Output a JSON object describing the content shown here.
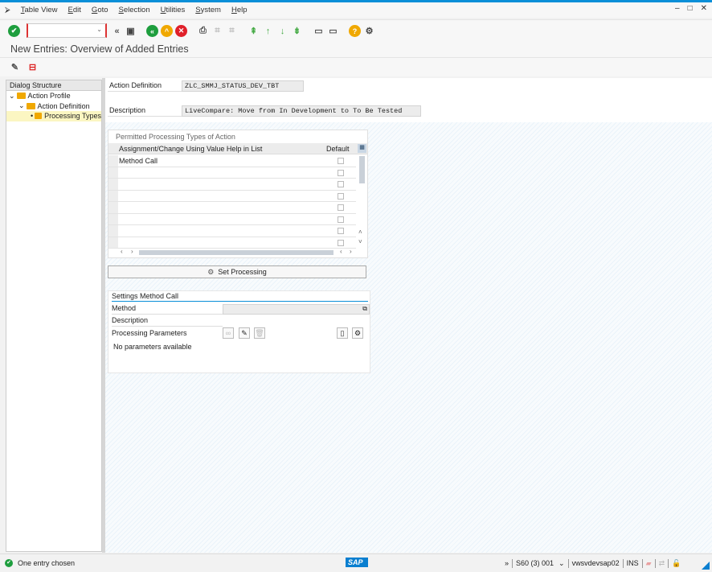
{
  "menu": [
    "Table View",
    "Edit",
    "Goto",
    "Selection",
    "Utilities",
    "System",
    "Help"
  ],
  "title": "New Entries: Overview of Added Entries",
  "dialog_structure": {
    "header": "Dialog Structure",
    "nodes": [
      {
        "label": "Action Profile"
      },
      {
        "label": "Action Definition"
      },
      {
        "label": "Processing Types",
        "selected": true
      }
    ]
  },
  "fields": {
    "action_definition_label": "Action Definition",
    "action_definition_value": "ZLC_SMMJ_STATUS_DEV_TBT",
    "description_label": "Description",
    "description_value": "LiveCompare: Move from In Development to To Be Tested"
  },
  "table": {
    "caption": "Permitted Processing Types of Action",
    "col_assignment": "Assignment/Change Using Value Help in List",
    "col_default": "Default",
    "rows": [
      {
        "value": "Method Call",
        "default": false
      },
      {
        "value": "",
        "default": false
      },
      {
        "value": "",
        "default": false
      },
      {
        "value": "",
        "default": false
      },
      {
        "value": "",
        "default": false
      },
      {
        "value": "",
        "default": false
      },
      {
        "value": "",
        "default": false
      },
      {
        "value": "",
        "default": false
      }
    ]
  },
  "set_processing_label": "Set Processing",
  "settings": {
    "title": "Settings Method Call",
    "method_label": "Method",
    "method_value": "",
    "description_label": "Description",
    "params_label": "Processing Parameters",
    "no_params": "No parameters available"
  },
  "status": {
    "message": "One entry chosen",
    "system": "S60 (3) 001",
    "server": "vwsvdevsap02",
    "mode": "INS",
    "logo": "SAP"
  },
  "colors": {
    "accent": "#0a8fd8",
    "ok": "#1e9e3e",
    "back": "#1e9e3e",
    "exit": "#f0a800",
    "cancel": "#e0202a",
    "folder": "#f0a800"
  }
}
